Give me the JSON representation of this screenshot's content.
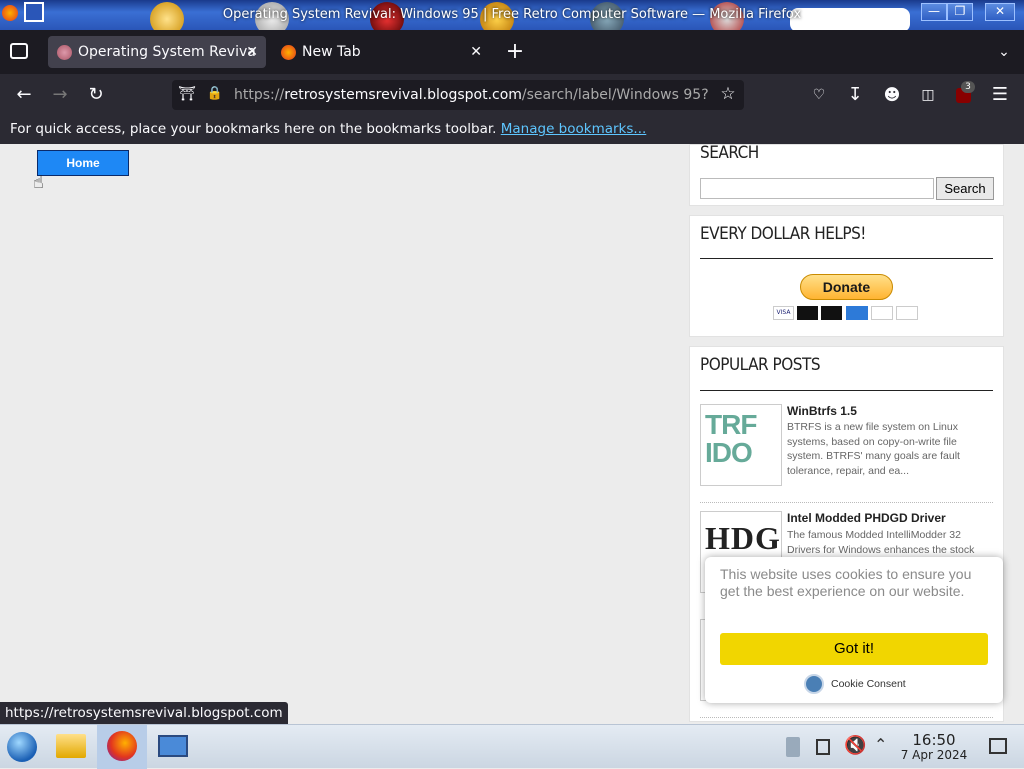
{
  "window": {
    "title": "Operating System Revival: Windows 95 | Free Retro Computer Software — Mozilla Firefox",
    "controls": [
      "minimize",
      "maximize",
      "close"
    ]
  },
  "tabs": [
    {
      "label": "Operating System Reviva",
      "active": true,
      "icon": "site-favicon"
    },
    {
      "label": "New Tab",
      "active": false,
      "icon": "firefox-icon"
    }
  ],
  "toolbar": {
    "url_prefix": "https://",
    "url_host": "retrosystemsrevival.blogspot.com",
    "url_path": "/search/label/Windows 95?",
    "extension_badge": "3"
  },
  "bookmarks": {
    "message": "For quick access, place your bookmarks here on the bookmarks toolbar.",
    "link": "Manage bookmarks..."
  },
  "page": {
    "home_button": "Home",
    "search_widget": {
      "title": "SEARCH",
      "button": "Search",
      "value": ""
    },
    "donate_widget": {
      "title": "EVERY DOLLAR HELPS!",
      "button": "Donate",
      "cards": [
        "VISA",
        "MC",
        "Maestro",
        "AMEX",
        "Discover",
        "PayPal"
      ]
    },
    "popular_widget": {
      "title": "POPULAR POSTS",
      "posts": [
        {
          "title": "WinBtrfs 1.5",
          "summary": "BTRFS is a new file system on Linux systems, based on copy-on-write file system. BTRFS' many goals are fault tolerance, repair, and ea...",
          "thumb_text": "TRF IDO"
        },
        {
          "title": "Intel Modded PHDGD Driver",
          "summary": "The famous Modded IntelliModder 32 Drivers for Windows enhances the stock",
          "thumb_text": "HDG"
        }
      ]
    }
  },
  "cookie": {
    "message": "This website uses cookies to ensure you get the best experience on our website.",
    "button": "Got it!",
    "brand": "Cookie Consent"
  },
  "status_url": "https://retrosystemsrevival.blogspot.com",
  "taskbar": {
    "time": "16:50",
    "date": "7 Apr 2024"
  },
  "colors": {
    "accent_blue": "#1e88f5",
    "cookie_yellow": "#f1d600",
    "tab_bg": "#1c1b22",
    "nav_bg": "#2b2a33"
  }
}
